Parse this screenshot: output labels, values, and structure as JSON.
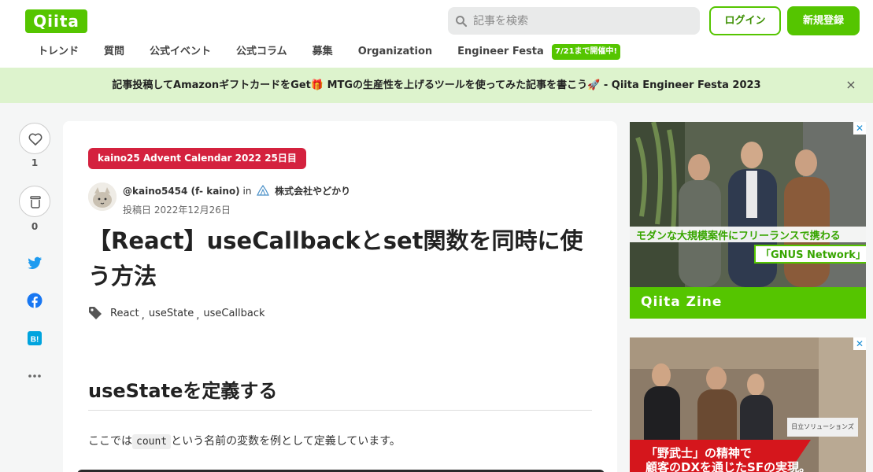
{
  "header": {
    "logo": "Qiita",
    "search_placeholder": "記事を検索",
    "login_label": "ログイン",
    "signup_label": "新規登録",
    "nav": [
      "トレンド",
      "質問",
      "公式イベント",
      "公式コラム",
      "募集",
      "Organization",
      "Engineer Festa"
    ],
    "nav_badge": "7/21まで開催中!"
  },
  "banner": {
    "text": "記事投稿してAmazonギフトカードをGet🎁 MTGの生産性を上げるツールを使ってみた記事を書こう🚀 - Qiita Engineer Festa 2023",
    "close": "×"
  },
  "actions": {
    "like_count": "1",
    "stock_count": "0"
  },
  "article": {
    "calendar_tag": "kaino25 Advent Calendar 2022 25日目",
    "author": "@kaino5454 (f- kaino)",
    "in": "in",
    "organization": "株式会社やどかり",
    "posted": "投稿日 2022年12月26日",
    "title": "【React】useCallbackとset関数を同時に使う方法",
    "tags": [
      "React",
      "useState",
      "useCallback"
    ],
    "h2": "useStateを定義する",
    "para_before": "ここでは",
    "para_code": "count",
    "para_after": "という名前の変数を例として定義しています。"
  },
  "ads": {
    "ad1_line1": "モダンな大規模案件にフリーランスで携わる",
    "ad1_line2": "「GNUS Network」",
    "ad1_brand": "Qiita Zine",
    "ad2_sign": "日立ソリューションズ",
    "ad2_line1": "「野武士」の精神で",
    "ad2_line2": "顧客のDXを通じたSFの実現。"
  },
  "colors": {
    "brand": "#55c500",
    "calendar_tag": "#d4213e",
    "banner_bg": "#ddf3cd"
  }
}
